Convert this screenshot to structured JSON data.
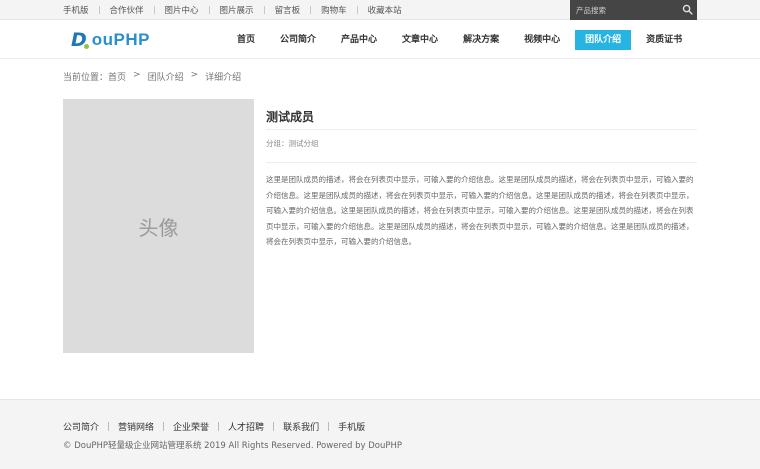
{
  "topbar": {
    "links": [
      "手机版",
      "合作伙伴",
      "图片中心",
      "图片展示",
      "留言板",
      "购物车",
      "收藏本站"
    ],
    "search_placeholder": "产品搜索"
  },
  "header": {
    "logo_first": "D",
    "logo_rest": "ouPHP",
    "nav": [
      "首页",
      "公司简介",
      "产品中心",
      "文章中心",
      "解决方案",
      "视频中心",
      "团队介绍",
      "资质证书"
    ],
    "active_nav": "团队介绍"
  },
  "breadcrumb": {
    "prefix": "当前位置：",
    "items": [
      "首页",
      "团队介绍",
      "详细介绍"
    ],
    "separator": ">"
  },
  "member": {
    "avatar_text": "头像",
    "name": "测试成员",
    "group_label": "分组：",
    "group_value": "测试分组",
    "description": "这里是团队成员的描述，将会在列表页中显示，可输入要的介绍信息。这里是团队成员的描述，将会在列表页中显示，可输入要的介绍信息。这里是团队成员的描述，将会在列表页中显示，可输入要的介绍信息。这里是团队成员的描述，将会在列表页中显示，可输入要的介绍信息。这里是团队成员的描述，将会在列表页中显示，可输入要的介绍信息。这里是团队成员的描述，将会在列表页中显示，可输入要的介绍信息。这里是团队成员的描述，将会在列表页中显示，可输入要的介绍信息。这里是团队成员的描述，将会在列表页中显示，可输入要的介绍信息。"
  },
  "footer": {
    "links": [
      "公司简介",
      "营销网络",
      "企业荣誉",
      "人才招聘",
      "联系我们",
      "手机版"
    ],
    "copyright": "© DouPHP轻量级企业网站管理系统 2019 All Rights Reserved. Powered by DouPHP"
  },
  "colors": {
    "accent": "#27b4e2",
    "logo_blue": "#2a8ed0",
    "logo_green": "#8cc63f",
    "search_bg": "#454545"
  }
}
